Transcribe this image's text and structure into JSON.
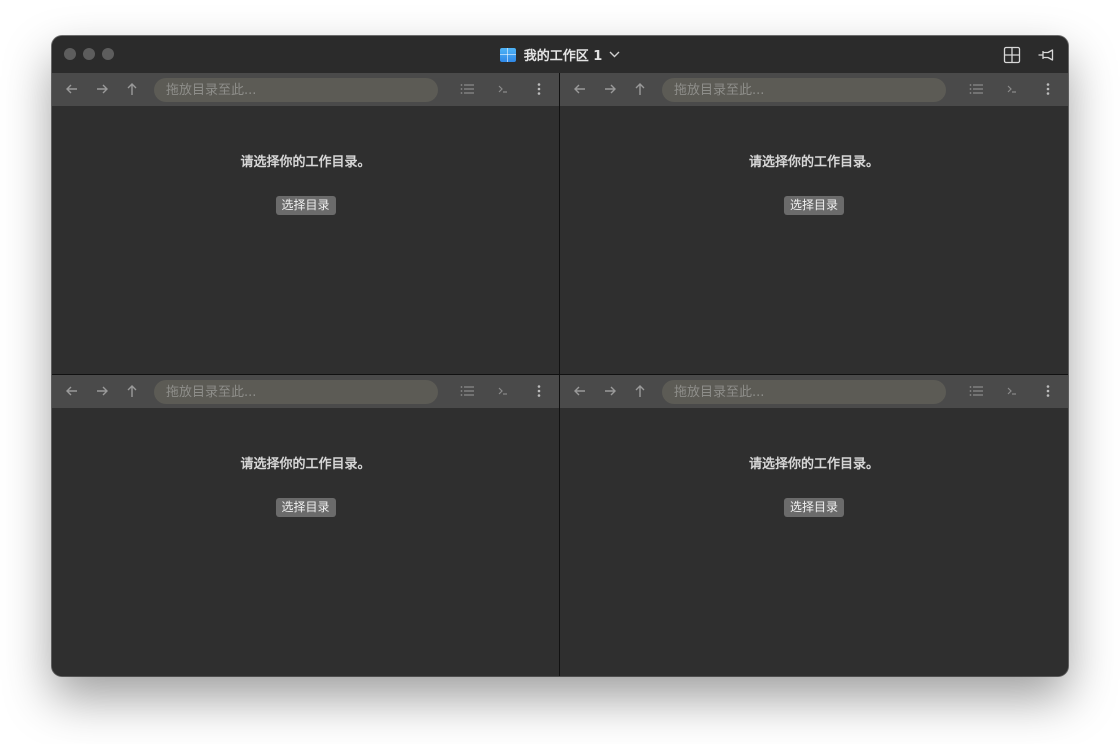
{
  "window": {
    "title": "我的工作区 1",
    "title_icon": "workspace-grid-icon",
    "title_icon_color": "#3a9bf0",
    "right_icons": [
      "layout-grid-icon",
      "pin-icon"
    ]
  },
  "toolbar": {
    "nav_icons": [
      "arrow-left-icon",
      "arrow-right-icon",
      "arrow-up-icon"
    ],
    "path_placeholder": "拖放目录至此...",
    "right_icons": [
      "list-view-icon",
      "terminal-icon",
      "more-vertical-icon"
    ]
  },
  "panes": [
    {
      "message": "请选择你的工作目录。",
      "button": "选择目录"
    },
    {
      "message": "请选择你的工作目录。",
      "button": "选择目录"
    },
    {
      "message": "请选择你的工作目录。",
      "button": "选择目录"
    },
    {
      "message": "请选择你的工作目录。",
      "button": "选择目录"
    }
  ],
  "colors": {
    "window_bg": "#2e2e2e",
    "toolbar_bg": "#4a4a4a",
    "input_bg": "#5c5b55",
    "button_bg": "#6b6b6b",
    "traffic_light": "#5d5d5d"
  }
}
